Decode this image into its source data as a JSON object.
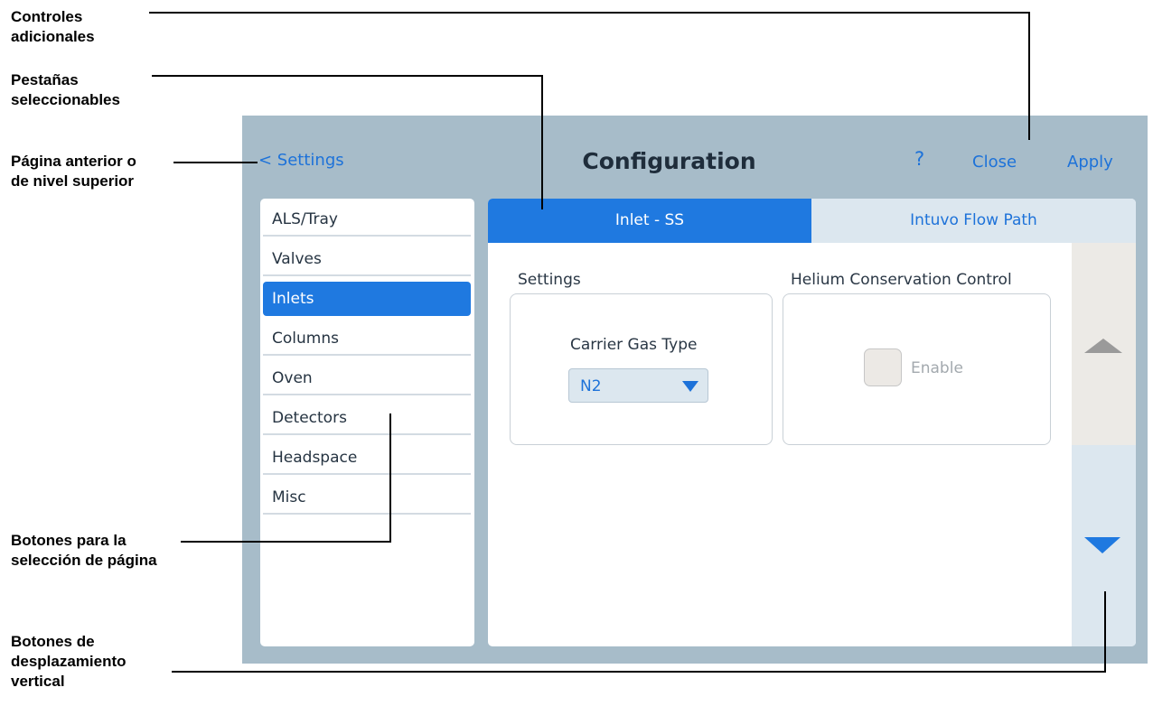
{
  "callouts": {
    "additional_controls": "Controles\nadicionales",
    "tabs": "Pestañas\nseleccionables",
    "previous_page": "Página anterior o\nde nivel superior",
    "page_buttons": "Botones para la\nselección de página",
    "scroll_buttons": "Botones de\ndesplazamiento\nvertical"
  },
  "header": {
    "back_label": "< Settings",
    "title": "Configuration",
    "help_label": "?",
    "close_label": "Close",
    "apply_label": "Apply"
  },
  "sidebar": {
    "items": [
      {
        "label": "ALS/Tray"
      },
      {
        "label": "Valves"
      },
      {
        "label": "Inlets"
      },
      {
        "label": "Columns"
      },
      {
        "label": "Oven"
      },
      {
        "label": "Detectors"
      },
      {
        "label": "Headspace"
      },
      {
        "label": "Misc"
      }
    ],
    "active_item": "Inlets"
  },
  "tabs": [
    {
      "label": "Inlet - SS"
    },
    {
      "label": "Intuvo Flow Path"
    }
  ],
  "active_tab": "Inlet - SS",
  "settings": {
    "section_label": "Settings",
    "carrier_gas_label": "Carrier Gas Type",
    "carrier_gas_value": "N2"
  },
  "helium": {
    "section_label": "Helium Conservation Control",
    "enable_label": "Enable",
    "enabled": false
  },
  "colors": {
    "accent": "#1f79e0",
    "screen_background": "#a7bcc9",
    "link": "#1d72d9"
  }
}
